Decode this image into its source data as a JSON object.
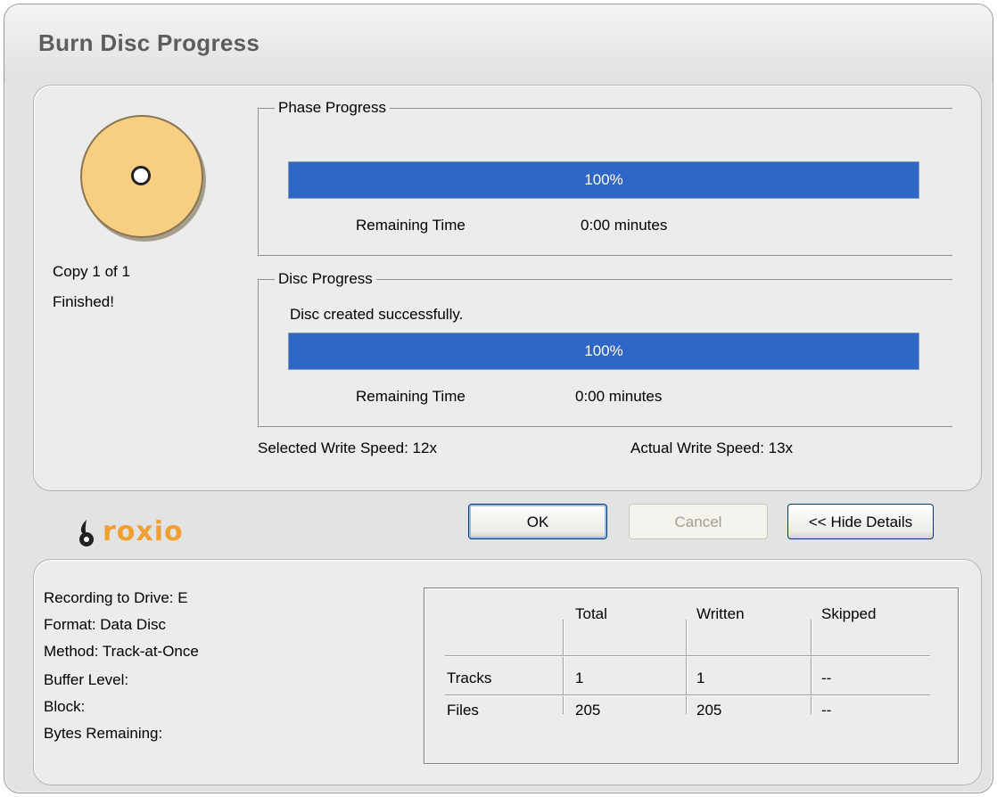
{
  "window": {
    "title": "Burn Disc Progress"
  },
  "status": {
    "copy": "Copy 1 of 1",
    "state": "Finished!"
  },
  "phase": {
    "legend": "Phase Progress",
    "progress": 100,
    "progress_label": "100%",
    "remaining_label": "Remaining Time",
    "remaining_value": "0:00 minutes"
  },
  "disc_progress": {
    "legend": "Disc Progress",
    "message": "Disc created successfully.",
    "progress": 100,
    "progress_label": "100%",
    "remaining_label": "Remaining Time",
    "remaining_value": "0:00 minutes"
  },
  "speeds": {
    "selected": "Selected Write Speed: 12x",
    "actual": "Actual Write Speed: 13x"
  },
  "buttons": {
    "ok": "OK",
    "cancel": "Cancel",
    "hide_details": "<< Hide Details"
  },
  "brand": {
    "logo_text": "roxio",
    "logo_color": "#f0a030"
  },
  "details": {
    "drive": "Recording to Drive: E",
    "format": "Format: Data Disc",
    "method": "Method: Track-at-Once",
    "buffer": "Buffer Level:",
    "block": "Block:",
    "bytes": "Bytes Remaining:"
  },
  "table": {
    "headers": [
      "Total",
      "Written",
      "Skipped"
    ],
    "rows": [
      {
        "label": "Tracks",
        "total": "1",
        "written": "1",
        "skipped": "--"
      },
      {
        "label": "Files",
        "total": "205",
        "written": "205",
        "skipped": "--"
      }
    ]
  },
  "colors": {
    "progress_fill": "#3066c8",
    "disc": "#f8cf82"
  }
}
